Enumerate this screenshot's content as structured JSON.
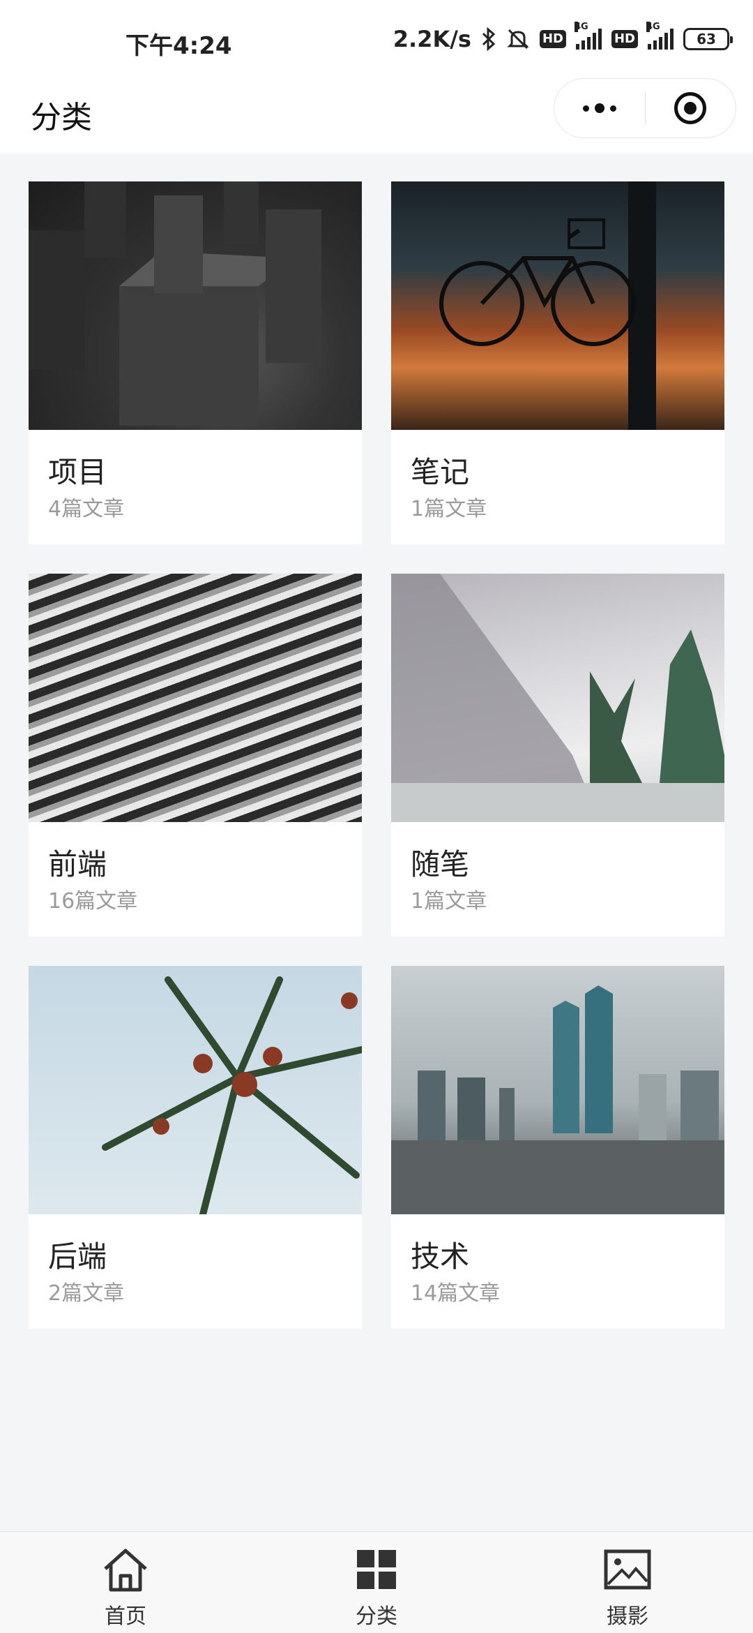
{
  "status_bar": {
    "time": "下午4:24",
    "net_speed": "2.2K/s",
    "network_1": "4G",
    "network_2": "4G",
    "hd_1": "HD",
    "hd_2": "HD",
    "battery": "63"
  },
  "header": {
    "title": "分类"
  },
  "categories": [
    {
      "name": "项目",
      "count": "4篇文章",
      "image": "stone-pillars"
    },
    {
      "name": "笔记",
      "count": "1篇文章",
      "image": "bicycle-night"
    },
    {
      "name": "前端",
      "count": "16篇文章",
      "image": "wood-texture"
    },
    {
      "name": "随笔",
      "count": "1篇文章",
      "image": "foggy-mountain"
    },
    {
      "name": "后端",
      "count": "2篇文章",
      "image": "palm-branches"
    },
    {
      "name": "技术",
      "count": "14篇文章",
      "image": "city-skyline"
    }
  ],
  "tabbar": {
    "items": [
      {
        "label": "首页",
        "icon": "home-icon"
      },
      {
        "label": "分类",
        "icon": "grid-icon"
      },
      {
        "label": "摄影",
        "icon": "image-icon"
      }
    ]
  }
}
